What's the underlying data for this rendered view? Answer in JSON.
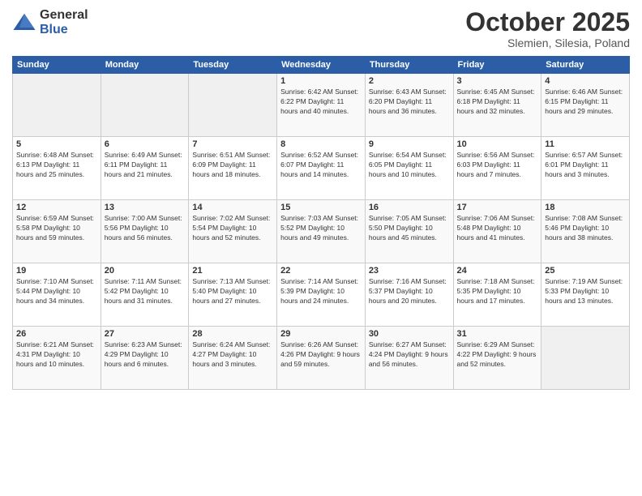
{
  "header": {
    "logo_line1": "General",
    "logo_line2": "Blue",
    "month": "October 2025",
    "location": "Slemien, Silesia, Poland"
  },
  "days_of_week": [
    "Sunday",
    "Monday",
    "Tuesday",
    "Wednesday",
    "Thursday",
    "Friday",
    "Saturday"
  ],
  "weeks": [
    [
      {
        "num": "",
        "detail": ""
      },
      {
        "num": "",
        "detail": ""
      },
      {
        "num": "",
        "detail": ""
      },
      {
        "num": "1",
        "detail": "Sunrise: 6:42 AM\nSunset: 6:22 PM\nDaylight: 11 hours\nand 40 minutes."
      },
      {
        "num": "2",
        "detail": "Sunrise: 6:43 AM\nSunset: 6:20 PM\nDaylight: 11 hours\nand 36 minutes."
      },
      {
        "num": "3",
        "detail": "Sunrise: 6:45 AM\nSunset: 6:18 PM\nDaylight: 11 hours\nand 32 minutes."
      },
      {
        "num": "4",
        "detail": "Sunrise: 6:46 AM\nSunset: 6:15 PM\nDaylight: 11 hours\nand 29 minutes."
      }
    ],
    [
      {
        "num": "5",
        "detail": "Sunrise: 6:48 AM\nSunset: 6:13 PM\nDaylight: 11 hours\nand 25 minutes."
      },
      {
        "num": "6",
        "detail": "Sunrise: 6:49 AM\nSunset: 6:11 PM\nDaylight: 11 hours\nand 21 minutes."
      },
      {
        "num": "7",
        "detail": "Sunrise: 6:51 AM\nSunset: 6:09 PM\nDaylight: 11 hours\nand 18 minutes."
      },
      {
        "num": "8",
        "detail": "Sunrise: 6:52 AM\nSunset: 6:07 PM\nDaylight: 11 hours\nand 14 minutes."
      },
      {
        "num": "9",
        "detail": "Sunrise: 6:54 AM\nSunset: 6:05 PM\nDaylight: 11 hours\nand 10 minutes."
      },
      {
        "num": "10",
        "detail": "Sunrise: 6:56 AM\nSunset: 6:03 PM\nDaylight: 11 hours\nand 7 minutes."
      },
      {
        "num": "11",
        "detail": "Sunrise: 6:57 AM\nSunset: 6:01 PM\nDaylight: 11 hours\nand 3 minutes."
      }
    ],
    [
      {
        "num": "12",
        "detail": "Sunrise: 6:59 AM\nSunset: 5:58 PM\nDaylight: 10 hours\nand 59 minutes."
      },
      {
        "num": "13",
        "detail": "Sunrise: 7:00 AM\nSunset: 5:56 PM\nDaylight: 10 hours\nand 56 minutes."
      },
      {
        "num": "14",
        "detail": "Sunrise: 7:02 AM\nSunset: 5:54 PM\nDaylight: 10 hours\nand 52 minutes."
      },
      {
        "num": "15",
        "detail": "Sunrise: 7:03 AM\nSunset: 5:52 PM\nDaylight: 10 hours\nand 49 minutes."
      },
      {
        "num": "16",
        "detail": "Sunrise: 7:05 AM\nSunset: 5:50 PM\nDaylight: 10 hours\nand 45 minutes."
      },
      {
        "num": "17",
        "detail": "Sunrise: 7:06 AM\nSunset: 5:48 PM\nDaylight: 10 hours\nand 41 minutes."
      },
      {
        "num": "18",
        "detail": "Sunrise: 7:08 AM\nSunset: 5:46 PM\nDaylight: 10 hours\nand 38 minutes."
      }
    ],
    [
      {
        "num": "19",
        "detail": "Sunrise: 7:10 AM\nSunset: 5:44 PM\nDaylight: 10 hours\nand 34 minutes."
      },
      {
        "num": "20",
        "detail": "Sunrise: 7:11 AM\nSunset: 5:42 PM\nDaylight: 10 hours\nand 31 minutes."
      },
      {
        "num": "21",
        "detail": "Sunrise: 7:13 AM\nSunset: 5:40 PM\nDaylight: 10 hours\nand 27 minutes."
      },
      {
        "num": "22",
        "detail": "Sunrise: 7:14 AM\nSunset: 5:39 PM\nDaylight: 10 hours\nand 24 minutes."
      },
      {
        "num": "23",
        "detail": "Sunrise: 7:16 AM\nSunset: 5:37 PM\nDaylight: 10 hours\nand 20 minutes."
      },
      {
        "num": "24",
        "detail": "Sunrise: 7:18 AM\nSunset: 5:35 PM\nDaylight: 10 hours\nand 17 minutes."
      },
      {
        "num": "25",
        "detail": "Sunrise: 7:19 AM\nSunset: 5:33 PM\nDaylight: 10 hours\nand 13 minutes."
      }
    ],
    [
      {
        "num": "26",
        "detail": "Sunrise: 6:21 AM\nSunset: 4:31 PM\nDaylight: 10 hours\nand 10 minutes."
      },
      {
        "num": "27",
        "detail": "Sunrise: 6:23 AM\nSunset: 4:29 PM\nDaylight: 10 hours\nand 6 minutes."
      },
      {
        "num": "28",
        "detail": "Sunrise: 6:24 AM\nSunset: 4:27 PM\nDaylight: 10 hours\nand 3 minutes."
      },
      {
        "num": "29",
        "detail": "Sunrise: 6:26 AM\nSunset: 4:26 PM\nDaylight: 9 hours\nand 59 minutes."
      },
      {
        "num": "30",
        "detail": "Sunrise: 6:27 AM\nSunset: 4:24 PM\nDaylight: 9 hours\nand 56 minutes."
      },
      {
        "num": "31",
        "detail": "Sunrise: 6:29 AM\nSunset: 4:22 PM\nDaylight: 9 hours\nand 52 minutes."
      },
      {
        "num": "",
        "detail": ""
      }
    ]
  ]
}
